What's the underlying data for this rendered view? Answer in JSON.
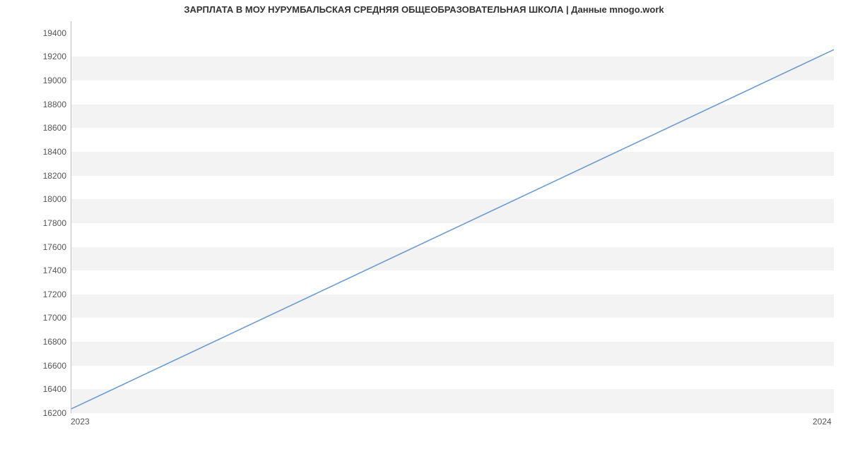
{
  "chart_data": {
    "type": "line",
    "title": "ЗАРПЛАТА В МОУ НУРУМБАЛЬСКАЯ СРЕДНЯЯ ОБЩЕОБРАЗОВАТЕЛЬНАЯ ШКОЛА | Данные mnogo.work",
    "xlabel": "",
    "ylabel": "",
    "x": [
      2023,
      2024
    ],
    "values": [
      16230,
      19260
    ],
    "x_ticks": [
      "2023",
      "2024"
    ],
    "y_ticks": [
      16200,
      16400,
      16600,
      16800,
      17000,
      17200,
      17400,
      17600,
      17800,
      18000,
      18200,
      18400,
      18600,
      18800,
      19000,
      19200,
      19400
    ],
    "ylim": [
      16200,
      19500
    ],
    "xlim": [
      2023,
      2024
    ],
    "line_color": "#6b9bd1",
    "grid_bands": true
  }
}
